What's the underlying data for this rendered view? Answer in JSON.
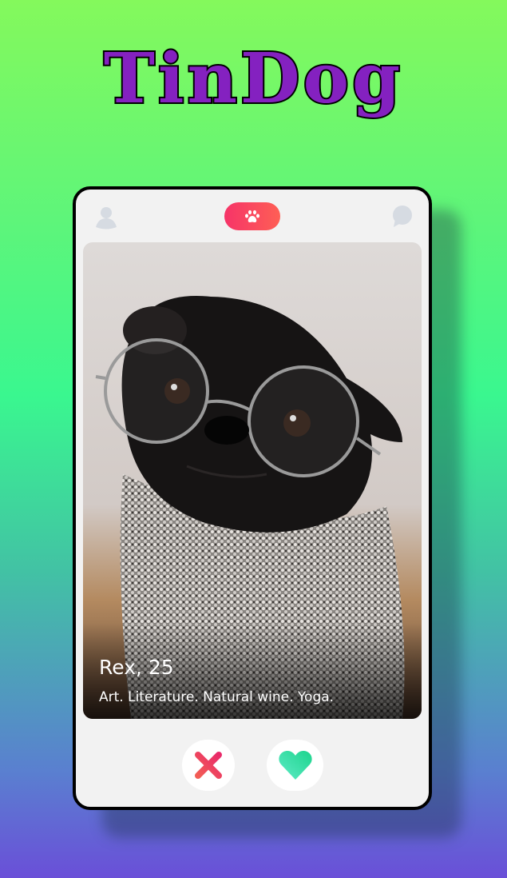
{
  "app": {
    "logo_text": "TinDog"
  },
  "card": {
    "header": {
      "left_icon": "person-icon",
      "center_icon": "paw-icon",
      "right_icon": "chat-bubble-icon"
    },
    "profile": {
      "name_age": "Rex, 25",
      "bio": "Art. Literature. Natural wine. Yoga.",
      "photo": "pug wearing round glasses and knitted scarf"
    },
    "actions": {
      "nope_icon": "x-icon",
      "like_icon": "heart-icon"
    }
  },
  "colors": {
    "logo": "#8421c0",
    "pill_start": "#f63468",
    "pill_end": "#fe5f55",
    "like": "#1fd796",
    "card_bg": "#f2f2f2"
  }
}
